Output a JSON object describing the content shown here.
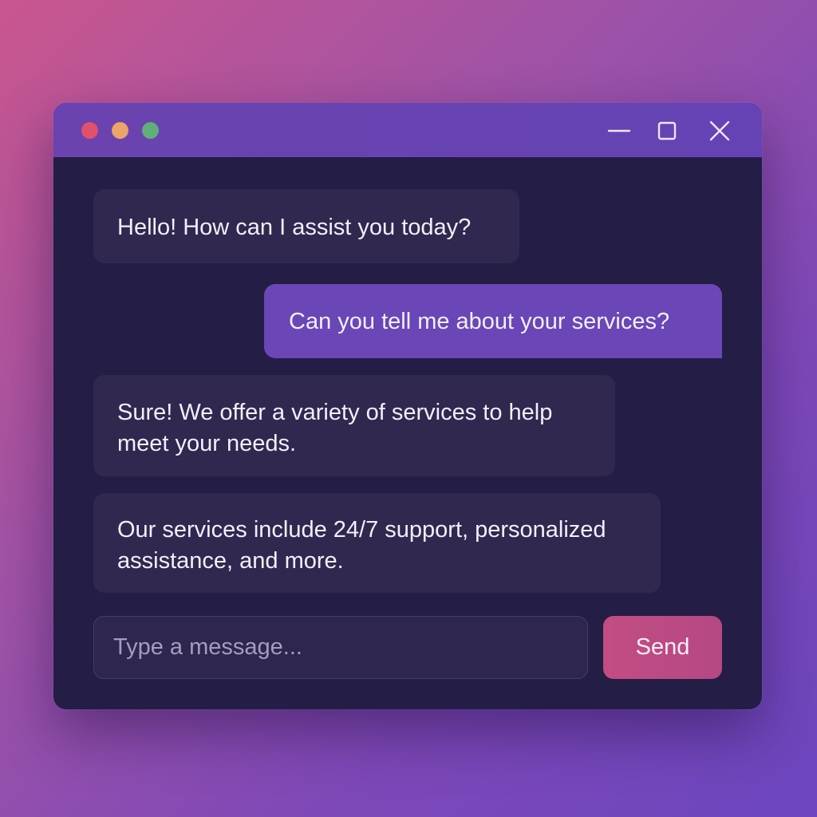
{
  "window": {
    "controls": {
      "minimize_icon": "minimize-icon",
      "maximize_icon": "maximize-icon",
      "close_icon": "close-icon"
    },
    "traffic_lights": [
      "#e0516c",
      "#eba46a",
      "#61ae7a"
    ]
  },
  "messages": [
    {
      "sender": "bot",
      "text": "Hello! How can I assist you today?"
    },
    {
      "sender": "user",
      "text": "Can you tell me about your services?"
    },
    {
      "sender": "bot",
      "text": "Sure! We offer a variety of services to help meet your needs."
    },
    {
      "sender": "bot",
      "text": "Our services include 24/7 support, personalized assistance, and more."
    }
  ],
  "composer": {
    "placeholder": "Type a message...",
    "value": "",
    "send_label": "Send"
  },
  "colors": {
    "accent": "#6a46b6",
    "send_button": "#c24d83",
    "window_bg": "#241d45",
    "bot_bubble": "#30284f"
  }
}
